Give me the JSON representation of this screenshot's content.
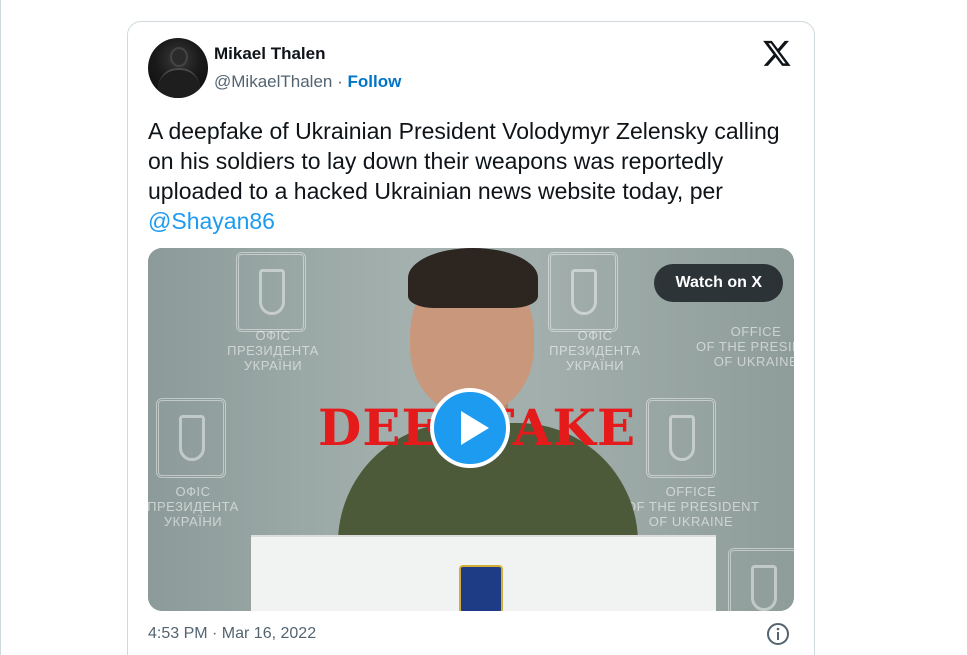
{
  "author": {
    "name": "Mikael Thalen",
    "handle": "@MikaelThalen",
    "separator": "·",
    "follow_label": "Follow"
  },
  "brand": {
    "logo_icon": "x-logo-icon"
  },
  "tweet": {
    "text": "A deepfake of Ukrainian President Volodymyr Zelensky calling on his soldiers to lay down their weapons was reportedly uploaded to a hacked Ukrainian news website today, per",
    "mention": "@Shayan86"
  },
  "media": {
    "watch_label": "Watch on X",
    "overlay_text": "DEEPFAKE",
    "play_icon": "play-icon",
    "wall_text_left_top": "ОФІС\nПРЕЗИДЕНТА\nУКРАЇНИ",
    "wall_text_right_top": "ОФІС\nПРЕЗИДЕНТА\nУКРАЇНИ",
    "wall_text_far_right": "OFFICE\nOF THE PRESIDENT\nOF UKRAINE",
    "wall_text_left_bottom": "ОФІС\nПРЕЗИДЕНТА\nУКРАЇНИ",
    "wall_text_right_bottom": "OFFICE\nOF THE PRESIDENT\nOF UKRAINE"
  },
  "footer": {
    "timestamp": "4:53 PM · Mar 16, 2022",
    "info_icon": "info-icon"
  },
  "colors": {
    "link": "#1d9bf0",
    "follow": "#0074c9",
    "overlay_red": "#e51b1b",
    "secondary_text": "#536471"
  }
}
